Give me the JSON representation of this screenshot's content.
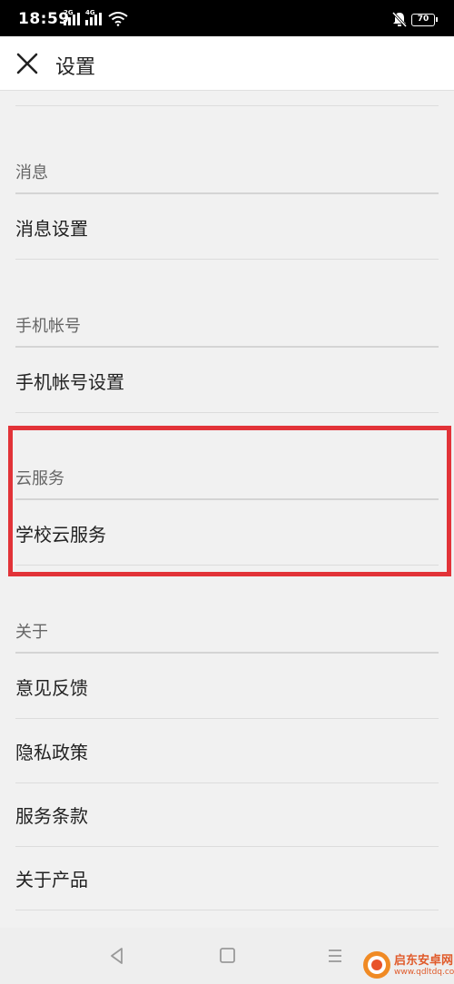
{
  "status_bar": {
    "time": "18:59",
    "network_1": "2G",
    "network_2": "4G",
    "battery": "70",
    "icons": [
      "signal-icon",
      "signal-icon",
      "wifi-icon",
      "mute-bell-icon",
      "battery-icon"
    ]
  },
  "header": {
    "close_icon": "close-icon",
    "title": "设置"
  },
  "sections": {
    "message": {
      "label": "消息",
      "items": [
        "消息设置"
      ]
    },
    "phone_account": {
      "label": "手机帐号",
      "items": [
        "手机帐号设置"
      ]
    },
    "cloud_service": {
      "label": "云服务",
      "items": [
        "学校云服务"
      ]
    },
    "about": {
      "label": "关于",
      "items": [
        "意见反馈",
        "隐私政策",
        "服务条款",
        "关于产品"
      ]
    }
  },
  "highlight_color": "#e23338",
  "nav_bar": {
    "icons": [
      "back-icon",
      "home-icon",
      "menu-icon"
    ]
  },
  "watermark": {
    "name": "启东安卓网",
    "url": "www.qdltdq.com"
  }
}
